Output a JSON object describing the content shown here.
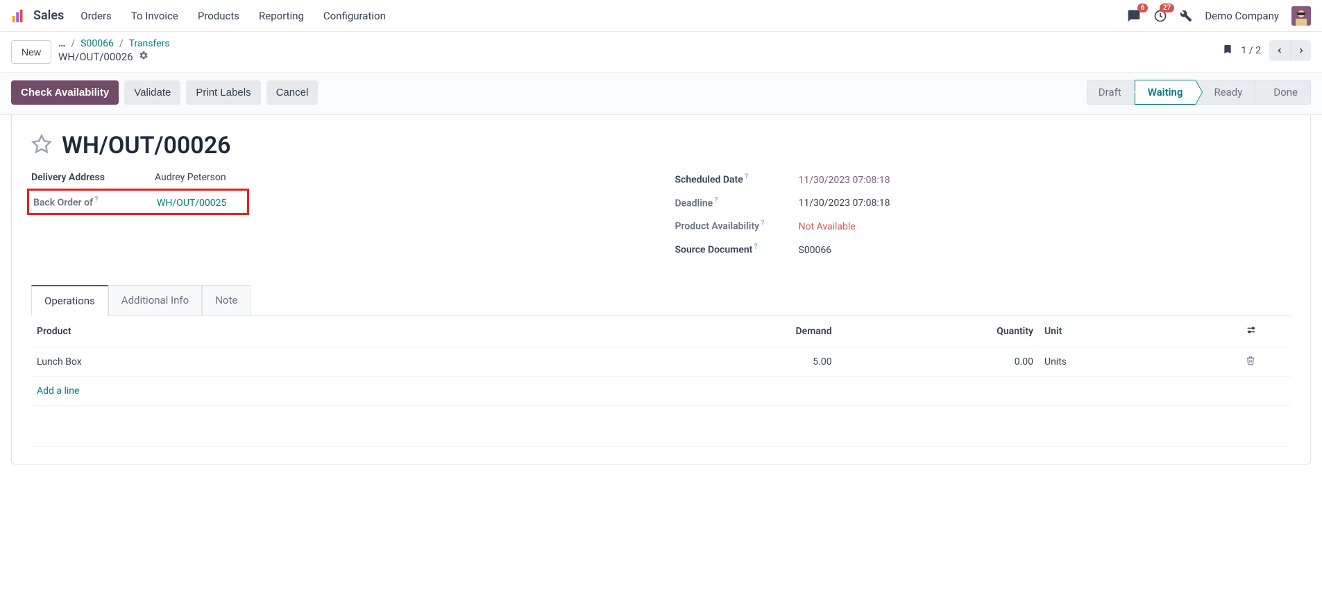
{
  "nav": {
    "brand": "Sales",
    "items": [
      "Orders",
      "To Invoice",
      "Products",
      "Reporting",
      "Configuration"
    ],
    "messages_count": "6",
    "activities_count": "27",
    "company": "Demo Company"
  },
  "breadcrumb": {
    "new_label": "New",
    "link1": "S00066",
    "link2": "Transfers",
    "current": "WH/OUT/00026",
    "pager": "1 / 2"
  },
  "actions": {
    "check_availability": "Check Availability",
    "validate": "Validate",
    "print_labels": "Print Labels",
    "cancel": "Cancel"
  },
  "status": {
    "draft": "Draft",
    "waiting": "Waiting",
    "ready": "Ready",
    "done": "Done"
  },
  "record": {
    "title": "WH/OUT/00026",
    "left": {
      "delivery_address_label": "Delivery Address",
      "delivery_address_value": "Audrey Peterson",
      "back_order_label": "Back Order of",
      "back_order_value": "WH/OUT/00025"
    },
    "right": {
      "scheduled_date_label": "Scheduled Date",
      "scheduled_date_value": "11/30/2023 07:08:18",
      "deadline_label": "Deadline",
      "deadline_value": "11/30/2023 07:08:18",
      "availability_label": "Product Availability",
      "availability_value": "Not Available",
      "source_doc_label": "Source Document",
      "source_doc_value": "S00066"
    }
  },
  "tabs": {
    "operations": "Operations",
    "additional": "Additional Info",
    "note": "Note"
  },
  "table": {
    "headers": {
      "product": "Product",
      "demand": "Demand",
      "quantity": "Quantity",
      "unit": "Unit"
    },
    "rows": [
      {
        "product": "Lunch Box",
        "demand": "5.00",
        "quantity": "0.00",
        "unit": "Units"
      }
    ],
    "add_line": "Add a line"
  }
}
